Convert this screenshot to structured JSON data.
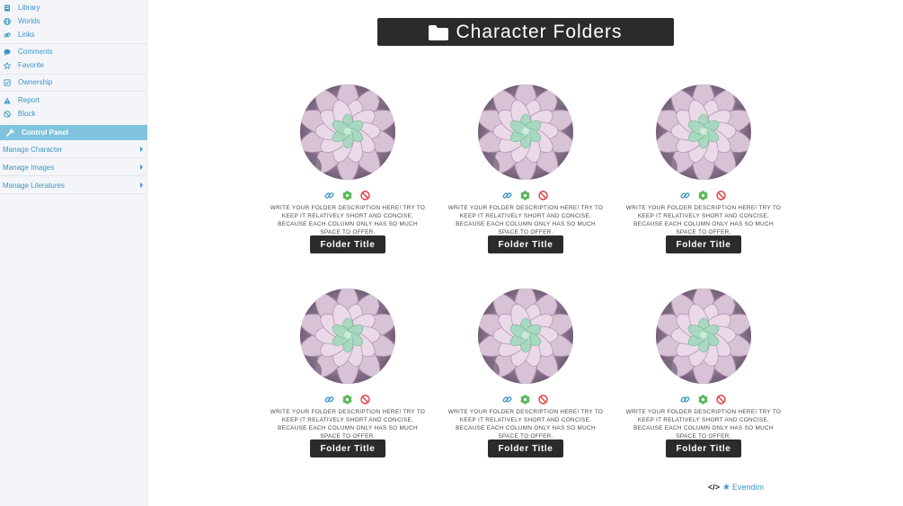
{
  "sidebar": {
    "items": [
      {
        "label": "Library",
        "icon": "book-icon"
      },
      {
        "label": "Worlds",
        "icon": "globe-icon"
      },
      {
        "label": "Links",
        "icon": "link-icon"
      },
      {
        "label": "Comments",
        "icon": "comment-icon"
      },
      {
        "label": "Favorite",
        "icon": "star-icon"
      },
      {
        "label": "Ownership",
        "icon": "check-square-icon"
      },
      {
        "label": "Report",
        "icon": "warning-icon"
      },
      {
        "label": "Block",
        "icon": "ban-icon"
      }
    ],
    "control_panel": {
      "label": "Control Panel",
      "icon": "wrench-icon"
    },
    "sub_items": [
      {
        "label": "Manage Character"
      },
      {
        "label": "Manage Images"
      },
      {
        "label": "Manage Literatures"
      }
    ]
  },
  "header": {
    "title": "Character Folders",
    "icon": "folder-icon"
  },
  "cards": [
    {
      "description": "Write your folder description here! Try to keep it relatively short and concise, because each column only has so much space to offer.",
      "title": "Folder Title"
    },
    {
      "description": "Write your folder description here! Try to keep it relatively short and concise, because each column only has so much space to offer.",
      "title": "Folder Title"
    },
    {
      "description": "Write your folder description here! Try to keep it relatively short and concise, because each column only has so much space to offer.",
      "title": "Folder Title"
    },
    {
      "description": "Write your folder description here! Try to keep it relatively short and concise, because each column only has so much space to offer.",
      "title": "Folder Title"
    },
    {
      "description": "Write your folder description here! Try to keep it relatively short and concise, because each column only has so much space to offer.",
      "title": "Folder Title"
    },
    {
      "description": "Write your folder description here! Try to keep it relatively short and concise, because each column only has so much space to offer.",
      "title": "Folder Title"
    }
  ],
  "card_icons": [
    "link-icon",
    "flower-icon",
    "ban-icon"
  ],
  "credit": {
    "code_symbol": "</>",
    "star": "★",
    "name": "Evendim"
  },
  "colors": {
    "accent": "#3b97c9",
    "control_panel": "#7fc3de",
    "dark": "#2b2b2b",
    "flower_icon": "#5cb85c",
    "ban_icon": "#e0393e"
  }
}
